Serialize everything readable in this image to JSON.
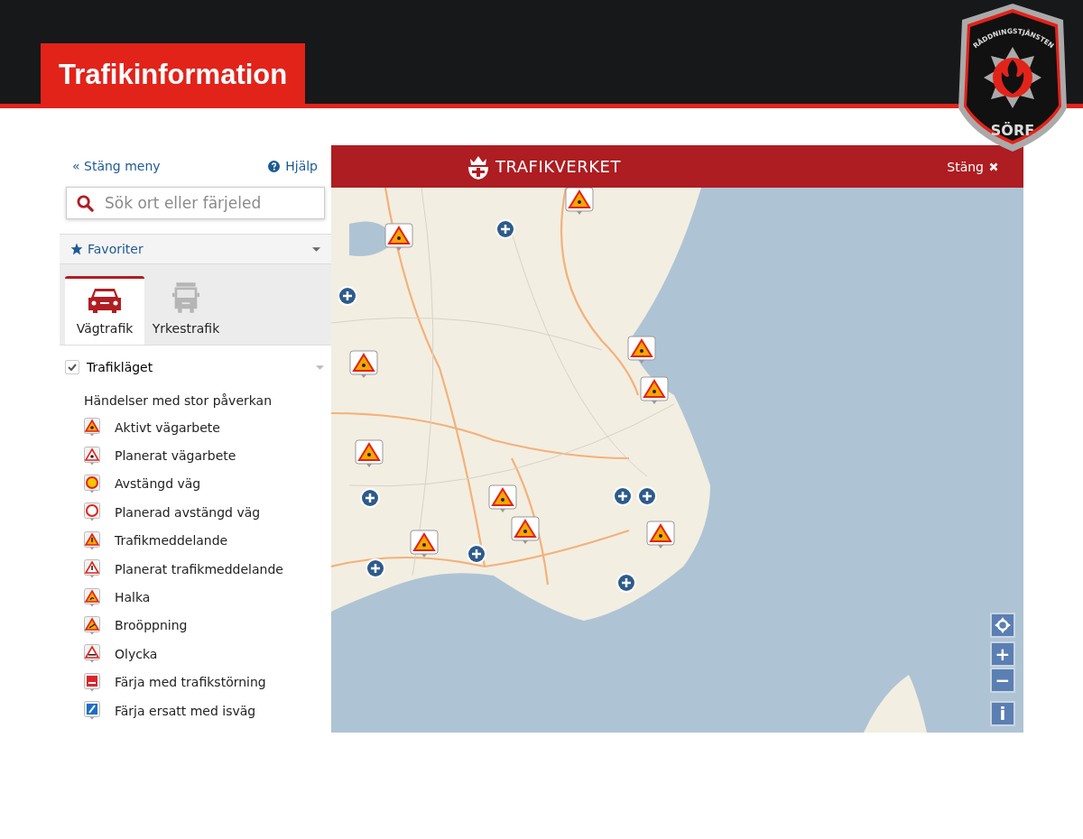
{
  "header": {
    "title": "Trafikinformation",
    "logo": {
      "arc_text": "RÅDDNINGSTJÄNSTEN",
      "name": "SÖRF"
    }
  },
  "sidebar": {
    "close_menu": "« Stäng meny",
    "help": "Hjälp",
    "search": {
      "placeholder": "Sök ort eller färjeled"
    },
    "favorites": "Favoriter",
    "tabs": [
      {
        "label": "Vägtrafik",
        "kind": "car",
        "selected": true
      },
      {
        "label": "Yrkestrafik",
        "kind": "truck",
        "selected": false
      }
    ],
    "layer": {
      "label": "Trafikläget",
      "checked": true
    },
    "legend_heading": "Händelser med stor påverkan",
    "legend": [
      {
        "label": "Aktivt vägarbete",
        "kind": "roadwork"
      },
      {
        "label": "Planerat vägarbete",
        "kind": "roadwork-planned"
      },
      {
        "label": "Avstängd väg",
        "kind": "closed"
      },
      {
        "label": "Planerad avstängd väg",
        "kind": "closed-planned"
      },
      {
        "label": "Trafikmeddelande",
        "kind": "warning"
      },
      {
        "label": "Planerat trafikmeddelande",
        "kind": "warning-planned"
      },
      {
        "label": "Halka",
        "kind": "slippery"
      },
      {
        "label": "Broöppning",
        "kind": "bridge"
      },
      {
        "label": "Olycka",
        "kind": "accident"
      },
      {
        "label": "Färja med trafikstörning",
        "kind": "ferry"
      },
      {
        "label": "Färja ersatt med isväg",
        "kind": "ice-road"
      }
    ]
  },
  "map": {
    "brand": "TRAFIKVERKET",
    "close": "Stäng",
    "controls": [
      {
        "kind": "locate"
      },
      {
        "kind": "zoom",
        "label": "+"
      },
      {
        "kind": "zoom",
        "label": "−"
      },
      {
        "kind": "info",
        "label": "i"
      }
    ]
  }
}
